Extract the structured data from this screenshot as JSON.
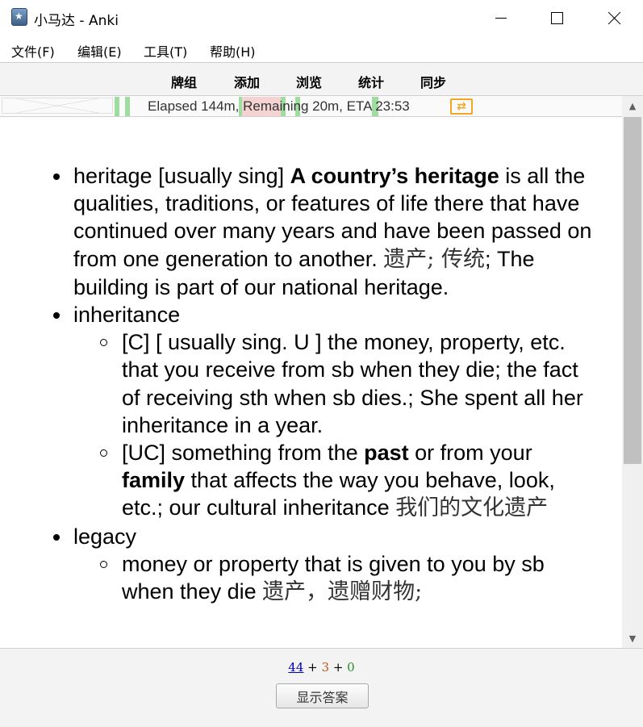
{
  "window": {
    "title": "小马达 - Anki"
  },
  "menu": [
    "文件(F)",
    "编辑(E)",
    "工具(T)",
    "帮助(H)"
  ],
  "toolbar": [
    "牌组",
    "添加",
    "浏览",
    "统计",
    "同步"
  ],
  "progress": {
    "text": "Elapsed 144m, Remaining 20m, ETA 23:53",
    "sync_glyph": "⇄",
    "colors": {
      "green": "#9fdc9f",
      "red": "#f6d3d3",
      "sync": "#f5a623"
    }
  },
  "card": {
    "items": [
      {
        "pre": "heritage [usually sing] ",
        "bold": "A country’s heritage",
        "post": " is all the qualities, traditions, or features of life there that have continued over many years and have been passed on from one generation to another. ",
        "cjk": "遗产; 传统",
        "end": "; The building is part of our national heritage."
      },
      {
        "text": "inheritance",
        "sub": [
          {
            "text": "[C] [ usually sing. U ] the money, property, etc. that you receive from sb when they die; the fact of receiving sth when sb dies.; She spent all her inheritance in a year."
          },
          {
            "a": "[UC] something from the ",
            "b1": "past",
            "c": " or from your ",
            "b2": "family",
            "d": " that affects the way you behave, look, etc.; our cultural inheritance ",
            "cjk": "我们的文化遗产"
          }
        ]
      },
      {
        "text": "legacy",
        "sub": [
          {
            "text": "money or property that is given to you by sb when they die ",
            "cjk": "遗产，遗赠财物;"
          }
        ]
      }
    ]
  },
  "footer": {
    "new_count": "44",
    "plus1": " + ",
    "learn_count": "3",
    "plus2": " + ",
    "review_count": "0",
    "show_answer": "显示答案"
  }
}
